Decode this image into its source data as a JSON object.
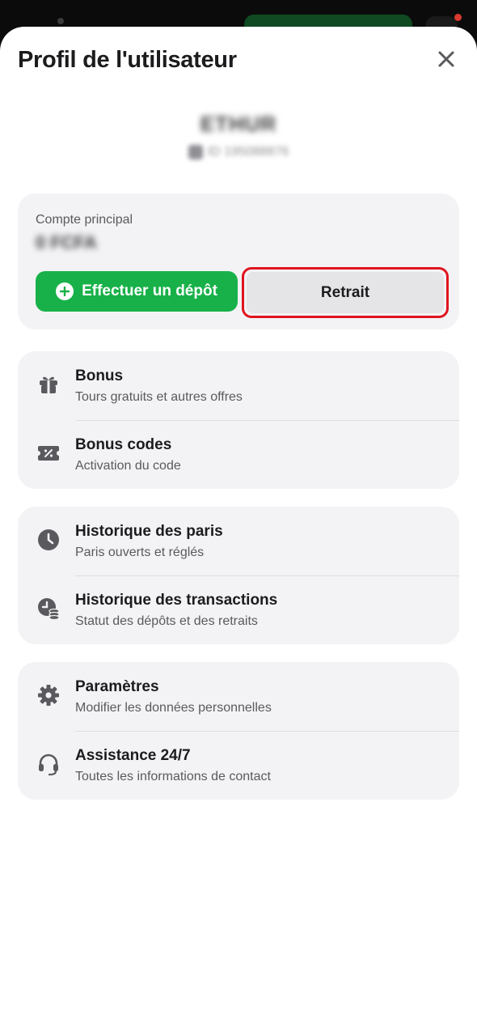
{
  "title": "Profil de l'utilisateur",
  "profile": {
    "username": "ETHUR",
    "user_id": "ID 195088876"
  },
  "account": {
    "label": "Compte principal",
    "balance": "0 FCFA",
    "deposit_label": "Effectuer un dépôt",
    "withdraw_label": "Retrait"
  },
  "menu_groups": [
    {
      "items": [
        {
          "label": "Bonus",
          "sub": "Tours gratuits et autres offres",
          "icon": "gift-icon"
        },
        {
          "label": "Bonus codes",
          "sub": "Activation du code",
          "icon": "ticket-percent-icon"
        }
      ]
    },
    {
      "items": [
        {
          "label": "Historique des paris",
          "sub": "Paris ouverts et réglés",
          "icon": "clock-icon"
        },
        {
          "label": "Historique des transactions",
          "sub": "Statut des dépôts et des retraits",
          "icon": "clock-coins-icon"
        }
      ]
    },
    {
      "items": [
        {
          "label": "Paramètres",
          "sub": "Modifier les données personnelles",
          "icon": "gear-icon"
        },
        {
          "label": "Assistance 24/7",
          "sub": "Toutes les informations de contact",
          "icon": "headset-icon"
        }
      ]
    }
  ],
  "colors": {
    "accent_green": "#18b149",
    "highlight_red": "#e0141e",
    "card_bg": "#f3f3f5",
    "icon_gray": "#5a5a5e"
  }
}
